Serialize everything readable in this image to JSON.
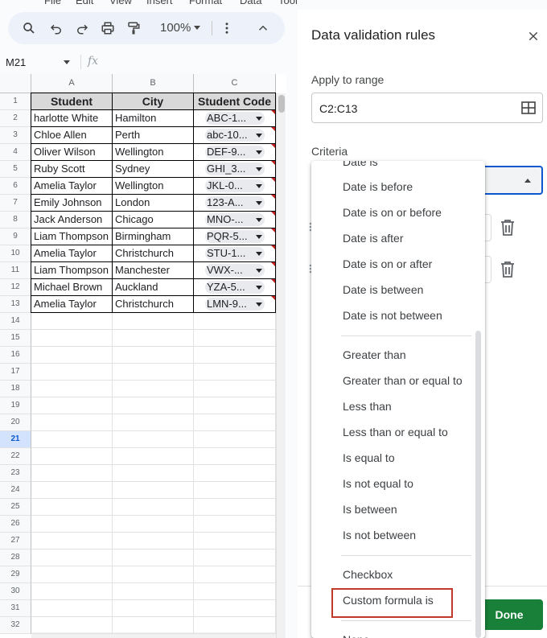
{
  "menubar": [
    "File",
    "Edit",
    "View",
    "Insert",
    "Format",
    "Data",
    "Tools"
  ],
  "toolbar": {
    "zoom": "100%"
  },
  "formula_bar": {
    "cell_ref": "M21",
    "fx_label": "fx"
  },
  "sheet": {
    "columns": [
      "A",
      "B",
      "C"
    ],
    "header": [
      "Student",
      "City",
      "Student Code"
    ],
    "rows": [
      [
        "harlotte White",
        "Hamilton",
        "ABC-1..."
      ],
      [
        "Chloe Allen",
        "Perth",
        "abc-10..."
      ],
      [
        "Oliver Wilson",
        "Wellington",
        "DEF-9..."
      ],
      [
        "Ruby Scott",
        "Sydney",
        "GHI_3..."
      ],
      [
        "Amelia Taylor",
        "Wellington",
        "JKL-0..."
      ],
      [
        "Emily Johnson",
        "London",
        "123-A..."
      ],
      [
        "Jack Anderson",
        "Chicago",
        "MNO-..."
      ],
      [
        "Liam Thompson",
        "Birmingham",
        "PQR-5..."
      ],
      [
        "Amelia Taylor",
        "Christchurch",
        "STU-1..."
      ],
      [
        "Liam Thompson",
        "Manchester",
        "VWX-..."
      ],
      [
        "Michael Brown",
        "Auckland",
        "YZA-5..."
      ],
      [
        "Amelia Taylor",
        "Christchurch",
        "LMN-9..."
      ]
    ],
    "row_numbers": [
      "1",
      "2",
      "3",
      "4",
      "5",
      "6",
      "7",
      "8",
      "9",
      "10",
      "11",
      "12",
      "13",
      "14",
      "15",
      "16",
      "17",
      "18",
      "19",
      "20",
      "21",
      "22",
      "23",
      "24",
      "25",
      "26",
      "27",
      "28",
      "29",
      "30",
      "31",
      "32"
    ],
    "selected_row": "21"
  },
  "panel": {
    "title": "Data validation rules",
    "apply_label": "Apply to range",
    "range_value": "C2:C13",
    "criteria_label": "Criteria",
    "done_label": "Done"
  },
  "menu": {
    "top_partial": "Date is",
    "group1": [
      "Date is before",
      "Date is on or before",
      "Date is after",
      "Date is on or after",
      "Date is between",
      "Date is not between"
    ],
    "group2": [
      "Greater than",
      "Greater than or equal to",
      "Less than",
      "Less than or equal to",
      "Is equal to",
      "Is not equal to",
      "Is between",
      "Is not between"
    ],
    "group3": [
      "Checkbox",
      "Custom formula is"
    ],
    "bottom_partial": "None"
  },
  "colors": {
    "done_green": "#188038",
    "focus_blue": "#0b57d0",
    "highlight_red": "#c0392b"
  }
}
